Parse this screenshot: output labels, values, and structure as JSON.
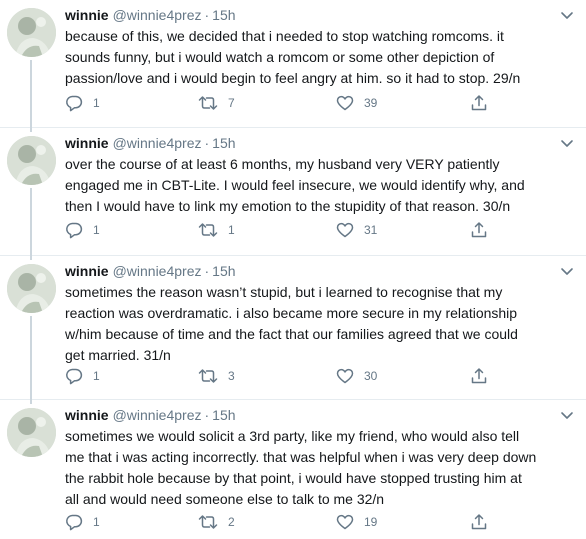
{
  "colors": {
    "text_primary": "#14171a",
    "text_secondary": "#657786",
    "divider": "#e6ecf0",
    "thread_line": "#ccd6dd"
  },
  "tweets": [
    {
      "name": "winnie",
      "handle": "@winnie4prez",
      "separator": "·",
      "time": "15h",
      "text": "because of this, we decided that i needed to stop watching romcoms. it\nsounds funny, but i would watch a romcom or some other depiction of\npassion/love and i would begin to feel angry at him. so it had to stop. 29/n",
      "replies": "1",
      "retweets": "7",
      "likes": "39",
      "icons": [
        "reply-icon",
        "retweet-icon",
        "like-icon",
        "share-icon",
        "caret-down-icon"
      ]
    },
    {
      "name": "winnie",
      "handle": "@winnie4prez",
      "separator": "·",
      "time": "15h",
      "text": "over the course of at least 6 months, my husband very VERY patiently\nengaged me in CBT-Lite.  I would feel insecure, we would identify why, and\nthen I would have to link my emotion to the stupidity of that reason. 30/n",
      "replies": "1",
      "retweets": "1",
      "likes": "31",
      "icons": [
        "reply-icon",
        "retweet-icon",
        "like-icon",
        "share-icon",
        "caret-down-icon"
      ]
    },
    {
      "name": "winnie",
      "handle": "@winnie4prez",
      "separator": "·",
      "time": "15h",
      "text": "sometimes the reason wasn’t stupid, but i learned to recognise that my\nreaction was overdramatic. i also became more secure in my relationship\nw/him because of time and the fact that our families agreed that we could\nget married. 31/n",
      "replies": "1",
      "retweets": "3",
      "likes": "30",
      "icons": [
        "reply-icon",
        "retweet-icon",
        "like-icon",
        "share-icon",
        "caret-down-icon"
      ]
    },
    {
      "name": "winnie",
      "handle": "@winnie4prez",
      "separator": "·",
      "time": "15h",
      "text": "sometimes we would solicit a 3rd party, like my friend, who would also tell\nme that i was acting incorrectly. that was helpful when i was very deep down\nthe rabbit hole because by that point, i would have stopped trusting him at\nall and would need someone else to talk to me 32/n",
      "replies": "1",
      "retweets": "2",
      "likes": "19",
      "icons": [
        "reply-icon",
        "retweet-icon",
        "like-icon",
        "share-icon",
        "caret-down-icon"
      ]
    }
  ]
}
